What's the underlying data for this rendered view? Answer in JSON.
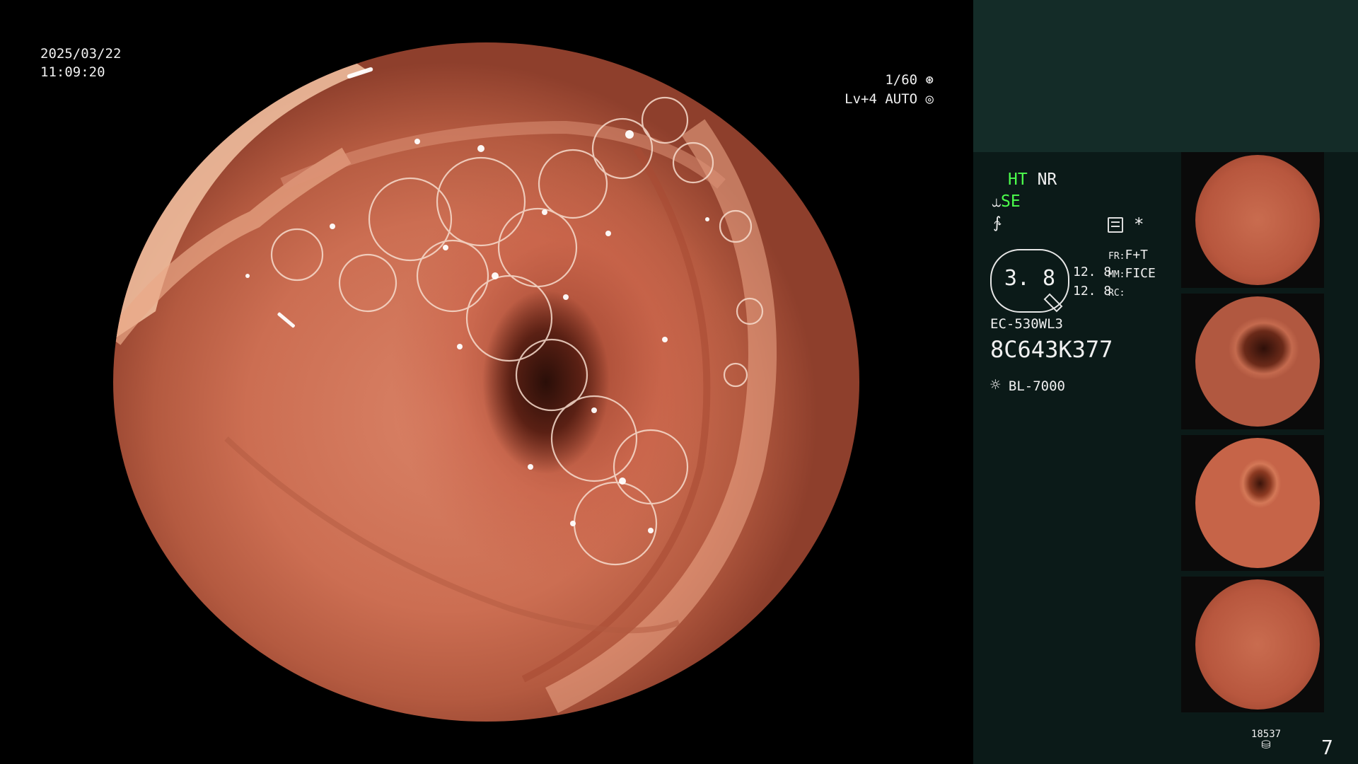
{
  "overlay": {
    "date": "2025/03/22",
    "time": "11:09:20",
    "shutter": "1/60",
    "shutter_icon": "aperture-icon",
    "brightness": "Lv+4 AUTO",
    "brightness_icon": "target-icon"
  },
  "panel": {
    "modes": {
      "ht": "HT",
      "nr": "NR",
      "se": "SE"
    },
    "icons": {
      "se_icon": "scope-icon",
      "wave_icon": "wave-icon",
      "memo_icon": "memo-icon",
      "star": "*"
    },
    "gauge_value": "3. 8",
    "gauge_side_top": "12. 8",
    "gauge_side_bottom": "12. 8",
    "settings": {
      "fr_label": "FR:",
      "fr_value": "F+T",
      "mm_label": "MM:",
      "mm_value": "FICE",
      "rc_label": "RC:"
    },
    "scope_model": "EC-530WL3",
    "serial": "8C643K377",
    "light_source": "BL-7000",
    "image_count": "18537",
    "page_number": "7"
  },
  "thumbnails": [
    {
      "name": "thumbnail-1",
      "style": "plain"
    },
    {
      "name": "thumbnail-2",
      "style": "dark"
    },
    {
      "name": "thumbnail-3",
      "style": "lum"
    },
    {
      "name": "thumbnail-4",
      "style": "plain"
    }
  ]
}
